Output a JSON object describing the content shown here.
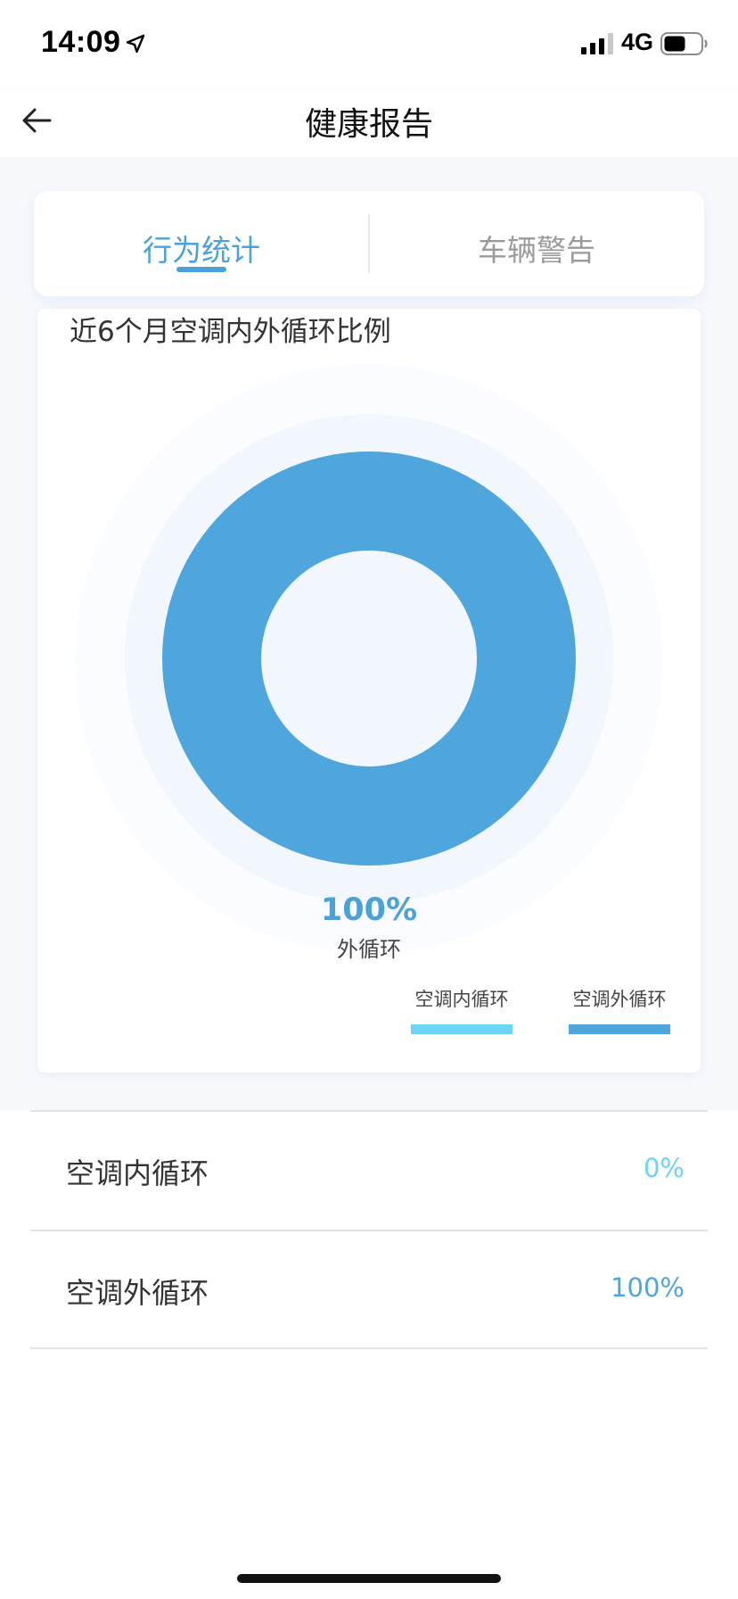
{
  "status_bar": {
    "time": "14:09",
    "network": "4G",
    "icons": [
      "location-arrow-icon",
      "signal-icon",
      "battery-icon"
    ]
  },
  "nav": {
    "title": "健康报告",
    "back_icon": "arrow-left-icon"
  },
  "tabs": [
    {
      "label": "行为统计",
      "active": true
    },
    {
      "label": "车辆警告",
      "active": false
    }
  ],
  "chart_data": {
    "type": "pie",
    "title": "近6个月空调内外循环比例",
    "series": [
      {
        "name": "空调内循环",
        "value": 0,
        "color": "#6dd3f7"
      },
      {
        "name": "空调外循环",
        "value": 100,
        "color": "#4ea6dc"
      }
    ],
    "center_value": "100%",
    "center_label": "外循环",
    "legend_placement": "bottom-right"
  },
  "stats": [
    {
      "label": "空调内循环",
      "value": "0%",
      "color": "#6dd3f7"
    },
    {
      "label": "空调外循环",
      "value": "100%",
      "color": "#4ea6dc"
    }
  ],
  "colors": {
    "accent": "#4aa2d8",
    "inner_circulation": "#6dd3f7",
    "outer_circulation": "#4ea6dc"
  }
}
